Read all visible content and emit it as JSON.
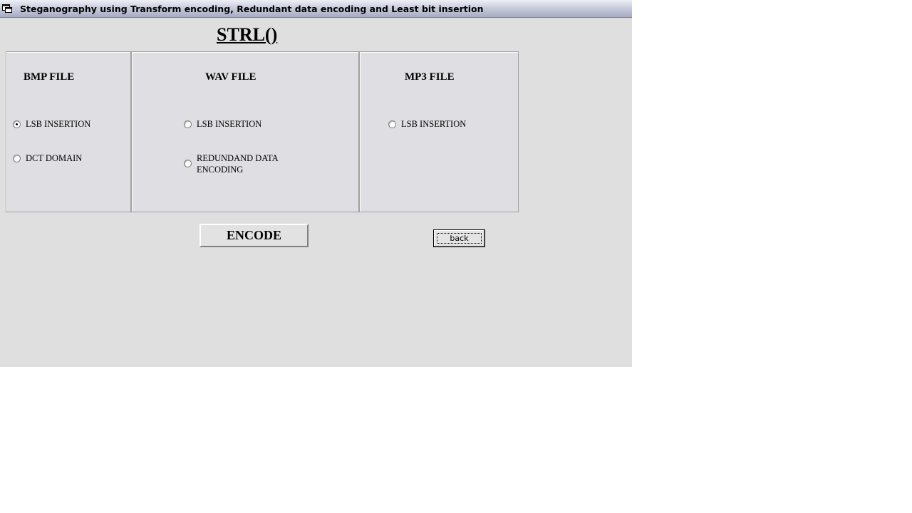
{
  "window": {
    "title": "Steganography using Transform encoding, Redundant data encoding and Least bit insertion",
    "icon": "window-icon"
  },
  "page": {
    "title": "STRL()"
  },
  "panels": {
    "bmp": {
      "title": "BMP FILE",
      "options": [
        {
          "label": "LSB INSERTION",
          "checked": true
        },
        {
          "label": "DCT DOMAIN",
          "checked": false
        }
      ]
    },
    "wav": {
      "title": "WAV FILE",
      "options": [
        {
          "label": "LSB INSERTION",
          "checked": false
        },
        {
          "label": "REDUNDAND DATA ENCODING",
          "checked": false
        }
      ]
    },
    "mp3": {
      "title": "MP3 FILE",
      "options": [
        {
          "label": "LSB INSERTION",
          "checked": false
        }
      ]
    }
  },
  "buttons": {
    "encode": "ENCODE",
    "back": "back"
  },
  "colors": {
    "window_bg": "#dfdfdf",
    "panel_bg": "#dfdfe3",
    "titlebar_gradient_end": "#a8acc4"
  }
}
